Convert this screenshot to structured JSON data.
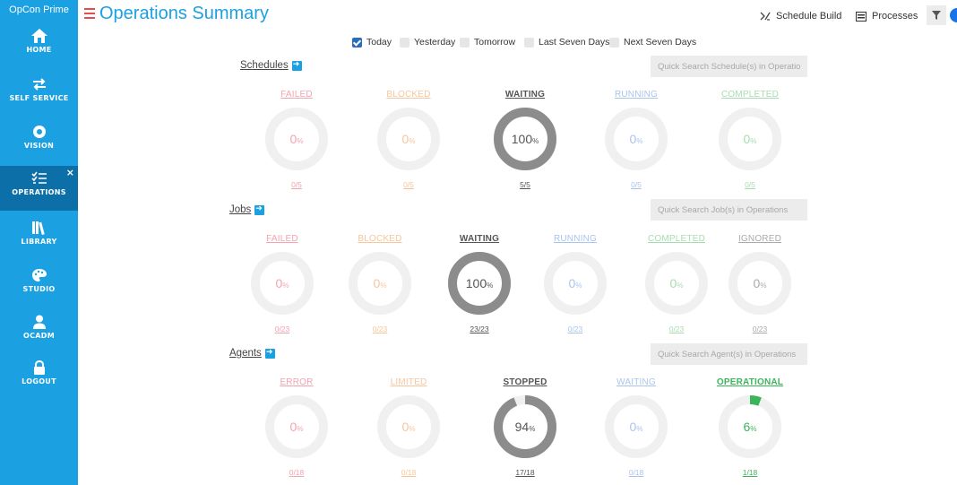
{
  "sidebar": {
    "brand": "OpCon Prime",
    "items": [
      {
        "label": "HOME",
        "icon": "home-icon"
      },
      {
        "label": "SELF SERVICE",
        "icon": "swap-arrows-icon"
      },
      {
        "label": "VISION",
        "icon": "eye-icon"
      },
      {
        "label": "OPERATIONS",
        "icon": "checklist-icon",
        "active": true
      },
      {
        "label": "LIBRARY",
        "icon": "library-icon"
      },
      {
        "label": "STUDIO",
        "icon": "palette-icon"
      },
      {
        "label": "OCADM",
        "icon": "user-icon"
      },
      {
        "label": "LOGOUT",
        "icon": "lock-icon"
      }
    ],
    "close_glyph": "×"
  },
  "header": {
    "title": "Operations Summary",
    "schedule_build": "Schedule Build",
    "processes": "Processes"
  },
  "date_filters": [
    {
      "label": "Today",
      "checked": true
    },
    {
      "label": "Yesterday",
      "checked": false
    },
    {
      "label": "Tomorrow",
      "checked": false
    },
    {
      "label": "Last Seven Days",
      "checked": false
    },
    {
      "label": "Next Seven Days",
      "checked": false
    }
  ],
  "sections": {
    "schedules": {
      "link": "Schedules",
      "search_placeholder": "Quick Search Schedule(s) in Operations",
      "stats": [
        {
          "title": "FAILED",
          "value": "0",
          "count": "0/5",
          "color": "#f4a3b0",
          "fraction": 0
        },
        {
          "title": "BLOCKED",
          "value": "0",
          "count": "0/5",
          "color": "#f7c69c",
          "fraction": 0
        },
        {
          "title": "WAITING",
          "value": "100",
          "count": "5/5",
          "color": "#555555",
          "fraction": 1
        },
        {
          "title": "RUNNING",
          "value": "0",
          "count": "0/5",
          "color": "#aac4ee",
          "fraction": 0
        },
        {
          "title": "COMPLETED",
          "value": "0",
          "count": "0/5",
          "color": "#a8dcb0",
          "fraction": 0
        }
      ]
    },
    "jobs": {
      "link": "Jobs",
      "search_placeholder": "Quick Search Job(s) in Operations",
      "stats": [
        {
          "title": "FAILED",
          "value": "0",
          "count": "0/23",
          "color": "#f4a3b0",
          "fraction": 0
        },
        {
          "title": "BLOCKED",
          "value": "0",
          "count": "0/23",
          "color": "#f7c69c",
          "fraction": 0
        },
        {
          "title": "WAITING",
          "value": "100",
          "count": "23/23",
          "color": "#555555",
          "fraction": 1
        },
        {
          "title": "RUNNING",
          "value": "0",
          "count": "0/23",
          "color": "#aac4ee",
          "fraction": 0
        },
        {
          "title": "COMPLETED",
          "value": "0",
          "count": "0/23",
          "color": "#a8dcb0",
          "fraction": 0
        },
        {
          "title": "IGNORED",
          "value": "0",
          "count": "0/23",
          "color": "#aaaaaa",
          "fraction": 0
        }
      ]
    },
    "agents": {
      "link": "Agents",
      "search_placeholder": "Quick Search Agent(s) in Operations",
      "stats": [
        {
          "title": "ERROR",
          "value": "0",
          "count": "0/18",
          "color": "#f4a3b0",
          "fraction": 0
        },
        {
          "title": "LIMITED",
          "value": "0",
          "count": "0/18",
          "color": "#f7c69c",
          "fraction": 0
        },
        {
          "title": "STOPPED",
          "value": "94",
          "count": "17/18",
          "color": "#555555",
          "fraction": 0.94
        },
        {
          "title": "WAITING",
          "value": "0",
          "count": "0/18",
          "color": "#aac4ee",
          "fraction": 0
        },
        {
          "title": "OPERATIONAL",
          "value": "6",
          "count": "1/18",
          "color": "#3cb45c",
          "fraction": 0.06
        }
      ]
    }
  },
  "percent_sign": "%",
  "colors": {
    "sidebar": "#1ba1e2",
    "sidebar_active": "#0d6fa8",
    "accent": "#1ba1e2",
    "ring_track": "#f0f0f0",
    "ring_fill": "#8c8c8c",
    "operational": "#3cb45c"
  }
}
